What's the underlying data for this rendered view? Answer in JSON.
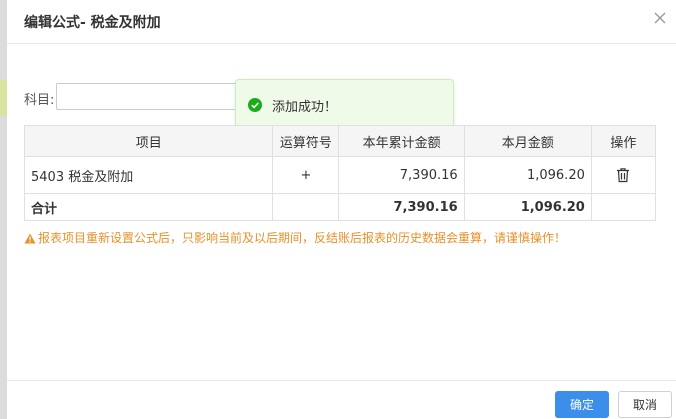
{
  "dialog": {
    "title": "编辑公式- 税金及附加",
    "close_icon": "close-icon"
  },
  "subject": {
    "label": "科目:",
    "value": "",
    "placeholder": ""
  },
  "toast": {
    "icon": "check-circle-icon",
    "message": "添加成功！",
    "color": "#1aad19"
  },
  "table": {
    "headers": [
      "项目",
      "运算符号",
      "本年累计金额",
      "本月金额",
      "操作"
    ],
    "rows": [
      {
        "item": "5403 税金及附加",
        "operator": "+",
        "year_total": "7,390.16",
        "month_amount": "1,096.20",
        "action_icon": "trash-icon"
      }
    ],
    "total": {
      "label": "合计",
      "operator": "",
      "year_total": "7,390.16",
      "month_amount": "1,096.20"
    }
  },
  "warning": {
    "icon": "warning-triangle-icon",
    "text": "报表项目重新设置公式后，只影响当前及以后期间，反结账后报表的历史数据会重算，请谨慎操作！",
    "color": "#e8902a"
  },
  "footer": {
    "ok_label": "确定",
    "cancel_label": "取消",
    "accent": "#3b8eea"
  }
}
